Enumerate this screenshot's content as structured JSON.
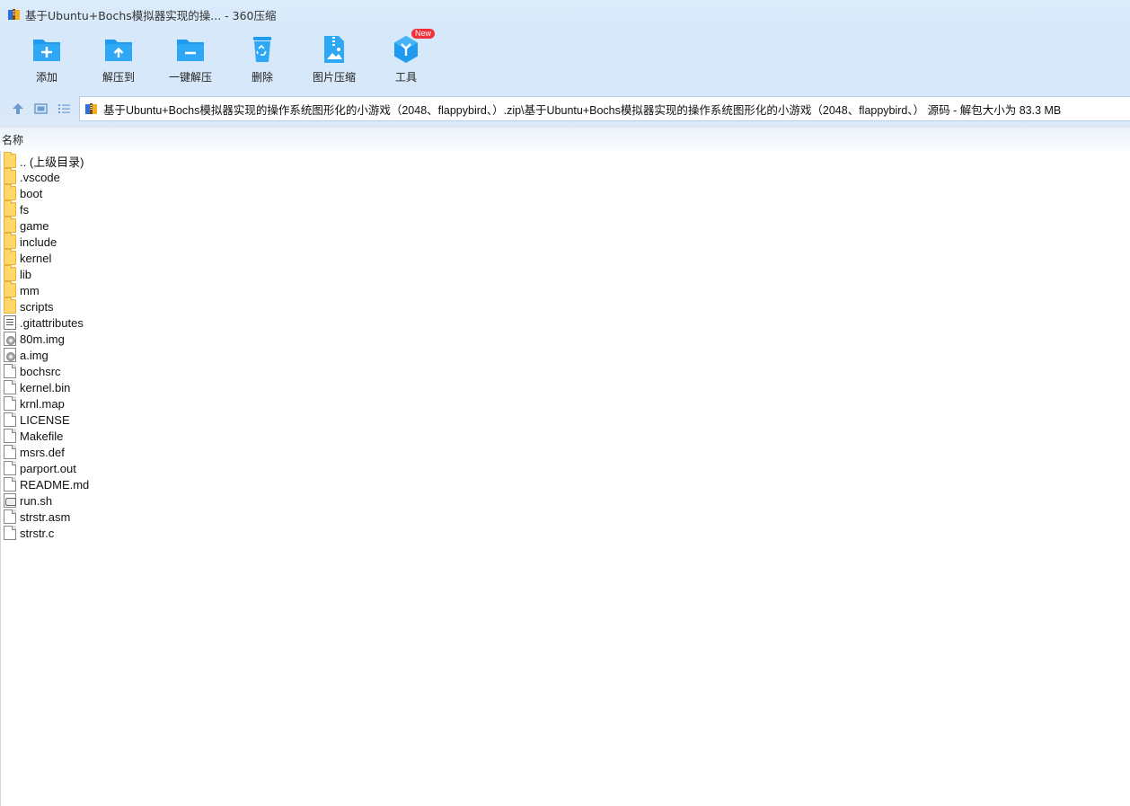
{
  "window": {
    "title": "基于Ubuntu+Bochs模拟器实现的操... - 360压缩"
  },
  "toolbar": {
    "items": [
      {
        "label": "添加",
        "icon": "add-folder-icon"
      },
      {
        "label": "解压到",
        "icon": "extract-to-icon"
      },
      {
        "label": "一键解压",
        "icon": "one-click-extract-icon"
      },
      {
        "label": "删除",
        "icon": "recycle-bin-icon"
      },
      {
        "label": "图片压缩",
        "icon": "image-compress-icon"
      },
      {
        "label": "工具",
        "icon": "tools-icon",
        "badge": "New"
      }
    ]
  },
  "navigation": {
    "up_icon": "arrow-up-icon",
    "view_icon": "thumbnail-view-icon",
    "list_icon": "list-view-icon"
  },
  "address": {
    "path": "基于Ubuntu+Bochs模拟器实现的操作系统图形化的小游戏（2048、flappybird、）.zip\\基于Ubuntu+Bochs模拟器实现的操作系统图形化的小游戏（2048、flappybird、） 源码 - 解包大小为 83.3 MB"
  },
  "list": {
    "column_name": "名称",
    "items": [
      {
        "name": ".. (上级目录)",
        "type": "folder"
      },
      {
        "name": ".vscode",
        "type": "folder"
      },
      {
        "name": "boot",
        "type": "folder"
      },
      {
        "name": "fs",
        "type": "folder"
      },
      {
        "name": "game",
        "type": "folder"
      },
      {
        "name": "include",
        "type": "folder"
      },
      {
        "name": "kernel",
        "type": "folder"
      },
      {
        "name": "lib",
        "type": "folder"
      },
      {
        "name": "mm",
        "type": "folder"
      },
      {
        "name": "scripts",
        "type": "folder"
      },
      {
        "name": ".gitattributes",
        "type": "text"
      },
      {
        "name": "80m.img",
        "type": "image"
      },
      {
        "name": "a.img",
        "type": "image"
      },
      {
        "name": "bochsrc",
        "type": "file"
      },
      {
        "name": "kernel.bin",
        "type": "file"
      },
      {
        "name": "krnl.map",
        "type": "file"
      },
      {
        "name": "LICENSE",
        "type": "file"
      },
      {
        "name": "Makefile",
        "type": "file"
      },
      {
        "name": "msrs.def",
        "type": "file"
      },
      {
        "name": "parport.out",
        "type": "file"
      },
      {
        "name": "README.md",
        "type": "file"
      },
      {
        "name": "run.sh",
        "type": "shell"
      },
      {
        "name": "strstr.asm",
        "type": "file"
      },
      {
        "name": "strstr.c",
        "type": "file"
      }
    ]
  },
  "colors": {
    "accent": "#1e9bf0",
    "toolbar_bg": "#d6e8fa",
    "folder": "#ffd76a",
    "badge": "#f0313a"
  }
}
